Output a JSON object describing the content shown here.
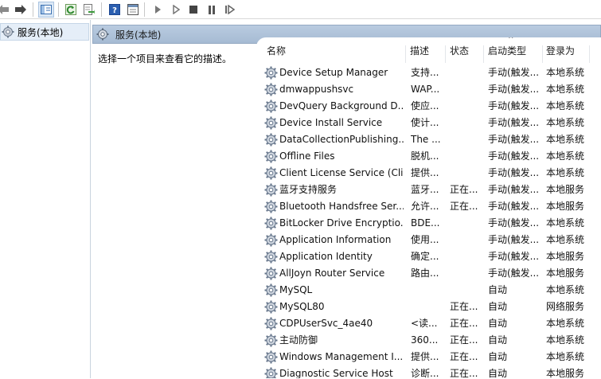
{
  "toolbar": {
    "buttons": [
      "back-icon",
      "forward-icon",
      "show-hide-tree-icon",
      "refresh-icon",
      "export-list-icon",
      "help-icon",
      "properties-icon",
      "start-service-icon",
      "start-service-alt-icon",
      "stop-service-icon",
      "pause-service-icon",
      "restart-service-icon"
    ]
  },
  "tree": {
    "root_label": "服务(本地)"
  },
  "pane": {
    "title": "服务(本地)",
    "description_hint": "选择一个项目来查看它的描述。"
  },
  "columns": {
    "name": "名称",
    "desc": "描述",
    "status": "状态",
    "startup": "启动类型",
    "logon": "登录为"
  },
  "services": [
    {
      "name": "Device Setup Manager",
      "desc": "支持...",
      "status": "",
      "startup": "手动(触发...",
      "logon": "本地系统"
    },
    {
      "name": "dmwappushsvc",
      "desc": "WAP...",
      "status": "",
      "startup": "手动(触发...",
      "logon": "本地系统"
    },
    {
      "name": "DevQuery Background D...",
      "desc": "使应...",
      "status": "",
      "startup": "手动(触发...",
      "logon": "本地系统"
    },
    {
      "name": "Device Install Service",
      "desc": "使计...",
      "status": "",
      "startup": "手动(触发...",
      "logon": "本地系统"
    },
    {
      "name": "DataCollectionPublishing...",
      "desc": "The ...",
      "status": "",
      "startup": "手动(触发...",
      "logon": "本地系统"
    },
    {
      "name": "Offline Files",
      "desc": "脱机...",
      "status": "",
      "startup": "手动(触发...",
      "logon": "本地系统"
    },
    {
      "name": "Client License Service (Cli...",
      "desc": "提供...",
      "status": "",
      "startup": "手动(触发...",
      "logon": "本地系统"
    },
    {
      "name": "蓝牙支持服务",
      "desc": "蓝牙...",
      "status": "正在...",
      "startup": "手动(触发...",
      "logon": "本地服务"
    },
    {
      "name": "Bluetooth Handsfree Ser...",
      "desc": "允许...",
      "status": "正在...",
      "startup": "手动(触发...",
      "logon": "本地服务"
    },
    {
      "name": "BitLocker Drive Encryptio...",
      "desc": "BDE...",
      "status": "",
      "startup": "手动(触发...",
      "logon": "本地系统"
    },
    {
      "name": "Application Information",
      "desc": "使用...",
      "status": "",
      "startup": "手动(触发...",
      "logon": "本地系统"
    },
    {
      "name": "Application Identity",
      "desc": "确定...",
      "status": "",
      "startup": "手动(触发...",
      "logon": "本地服务"
    },
    {
      "name": "AllJoyn Router Service",
      "desc": "路由...",
      "status": "",
      "startup": "手动(触发...",
      "logon": "本地服务"
    },
    {
      "name": "MySQL",
      "desc": "",
      "status": "",
      "startup": "自动",
      "logon": "本地系统"
    },
    {
      "name": "MySQL80",
      "desc": "",
      "status": "正在...",
      "startup": "自动",
      "logon": "网络服务"
    },
    {
      "name": "CDPUserSvc_4ae40",
      "desc": "<读...",
      "status": "正在...",
      "startup": "自动",
      "logon": "本地系统"
    },
    {
      "name": "主动防御",
      "desc": "360...",
      "status": "正在...",
      "startup": "自动",
      "logon": "本地系统"
    },
    {
      "name": "Windows Management I...",
      "desc": "提供...",
      "status": "正在...",
      "startup": "自动",
      "logon": "本地系统"
    },
    {
      "name": "Diagnostic Service Host",
      "desc": "诊断...",
      "status": "正在...",
      "startup": "自动",
      "logon": "本地服务"
    }
  ],
  "colors": {
    "header_bg": "#a6bbd3",
    "tree_selected": "#e5eef8",
    "accent_blue": "#2b63b5",
    "play_gray": "#6a6a6a"
  }
}
